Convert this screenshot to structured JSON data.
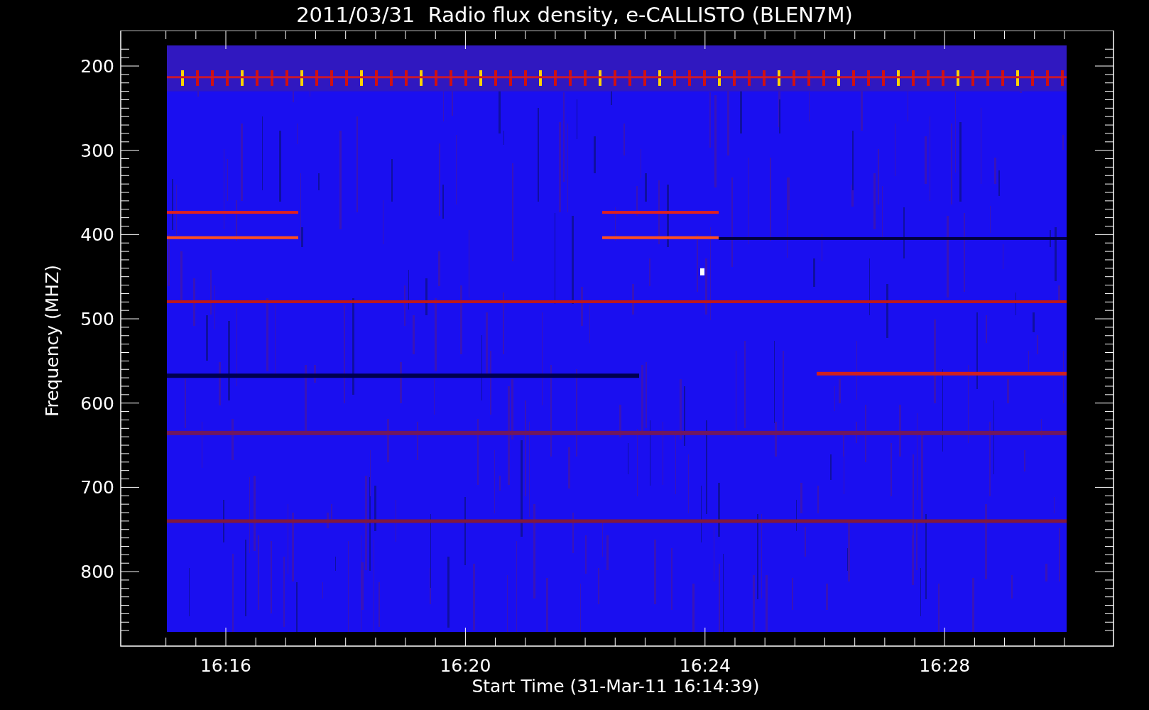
{
  "title": "2011/03/31  Radio flux density, e-CALLISTO (BLEN7M)",
  "y_axis": {
    "label": "Frequency (MHZ)",
    "ticks": [
      "200",
      "300",
      "400",
      "500",
      "600",
      "700",
      "800"
    ]
  },
  "x_axis": {
    "label": "Start Time (31-Mar-11 16:14:39)",
    "ticks": [
      "16:16",
      "16:20",
      "16:24",
      "16:28"
    ]
  }
}
